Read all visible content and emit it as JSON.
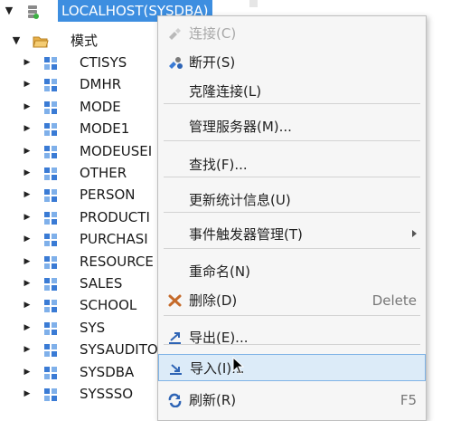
{
  "tree": {
    "root": {
      "label": "LOCALHOST(SYSDBA)"
    },
    "schema_group": {
      "label": "模式"
    },
    "schemas": [
      "CTISYS",
      "DMHR",
      "MODE",
      "MODE1",
      "MODEUSEI",
      "OTHER",
      "PERSON",
      "PRODUCTI",
      "PURCHASI",
      "RESOURCE",
      "SALES",
      "SCHOOL",
      "SYS",
      "SYSAUDITO",
      "SYSDBA",
      "SYSSSO"
    ]
  },
  "context_menu": {
    "items": [
      {
        "label": "连接(C)",
        "icon": "connect-icon",
        "disabled": true
      },
      {
        "label": "断开(S)",
        "icon": "disconnect-icon"
      },
      {
        "label": "克隆连接(L)"
      },
      {
        "label": "管理服务器(M)..."
      },
      {
        "label": "查找(F)..."
      },
      {
        "label": "更新统计信息(U)"
      },
      {
        "label": "事件触发器管理(T)",
        "submenu": true
      },
      {
        "label": "重命名(N)"
      },
      {
        "label": "删除(D)",
        "icon": "delete-icon",
        "shortcut": "Delete"
      },
      {
        "label": "导出(E)...",
        "icon": "export-icon"
      },
      {
        "label": "导入(I)...",
        "icon": "import-icon",
        "hover": true
      },
      {
        "label": "刷新(R)",
        "icon": "refresh-icon",
        "shortcut": "F5"
      }
    ]
  },
  "colors": {
    "selection": "#3d8ee0",
    "menu_hover": "#dcebf8",
    "schema_icon": "#3a7bd5",
    "folder": "#e8b04a"
  }
}
